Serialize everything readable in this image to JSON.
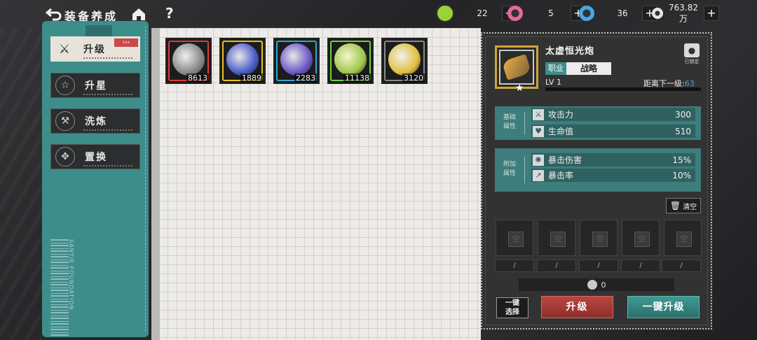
{
  "header": {
    "title": "装备养成",
    "back_icon": "back-arrow-icon",
    "home_icon": "home-icon",
    "help_label": "?"
  },
  "resources": [
    {
      "icon": "green-eye-token-icon",
      "value": "22",
      "color": "#9bd23a"
    },
    {
      "icon": "pink-orb-token-icon",
      "value": "5",
      "color": "#e5679b"
    },
    {
      "icon": "blue-ring-token-icon",
      "value": "36",
      "color": "#45a7e5"
    },
    {
      "icon": "coin-icon",
      "value": "763.82万",
      "color": "#d9d9d9"
    }
  ],
  "sidebar": {
    "items": [
      {
        "label": "升级",
        "icon": "upgrade-swords-icon",
        "active": true
      },
      {
        "label": "升星",
        "icon": "star-icon",
        "active": false
      },
      {
        "label": "洗炼",
        "icon": "refine-hammer-icon",
        "active": false
      },
      {
        "label": "置换",
        "icon": "swap-icon",
        "active": false
      }
    ],
    "footer_text": "SANTIE FOUNDATION"
  },
  "inventory": [
    {
      "count": "8613",
      "frame_color": "#e03a3a",
      "orb": "#d9d9d9"
    },
    {
      "count": "1889",
      "frame_color": "#e7c21d",
      "orb": "#4a5cc8"
    },
    {
      "count": "2283",
      "frame_color": "#2fa7d6",
      "orb": "#6b57c8"
    },
    {
      "count": "11138",
      "frame_color": "#6fd23a",
      "orb": "#c9e86a"
    },
    {
      "count": "3120",
      "frame_color": "#8a8a8a",
      "orb": "#e0c040"
    }
  ],
  "equipment": {
    "name": "太虚恒光炮",
    "lock_label": "已锁定",
    "job_label": "职业",
    "job_value": "战略",
    "level": "LV 1",
    "next_level_label": "距离下一级:",
    "next_level_value": "63",
    "xp_fraction": 0
  },
  "base_stats": {
    "group_label": "基础属性",
    "rows": [
      {
        "name": "攻击力",
        "value": "300",
        "icon": "attack-icon"
      },
      {
        "name": "生命值",
        "value": "510",
        "icon": "heart-icon"
      }
    ]
  },
  "extra_stats": {
    "group_label": "附加属性",
    "rows": [
      {
        "name": "暴击伤害",
        "value": "15%",
        "icon": "crit-damage-icon"
      },
      {
        "name": "暴击率",
        "value": "10%",
        "icon": "crit-rate-icon"
      }
    ]
  },
  "clear_label": "清空",
  "slots": {
    "placeholder": "空",
    "count_placeholder": "/"
  },
  "cost": "0",
  "buttons": {
    "auto_select": "一键\n选择",
    "auto_select_line1": "一键",
    "auto_select_line2": "选择",
    "upgrade": "升级",
    "upgrade_all": "一键升级"
  }
}
